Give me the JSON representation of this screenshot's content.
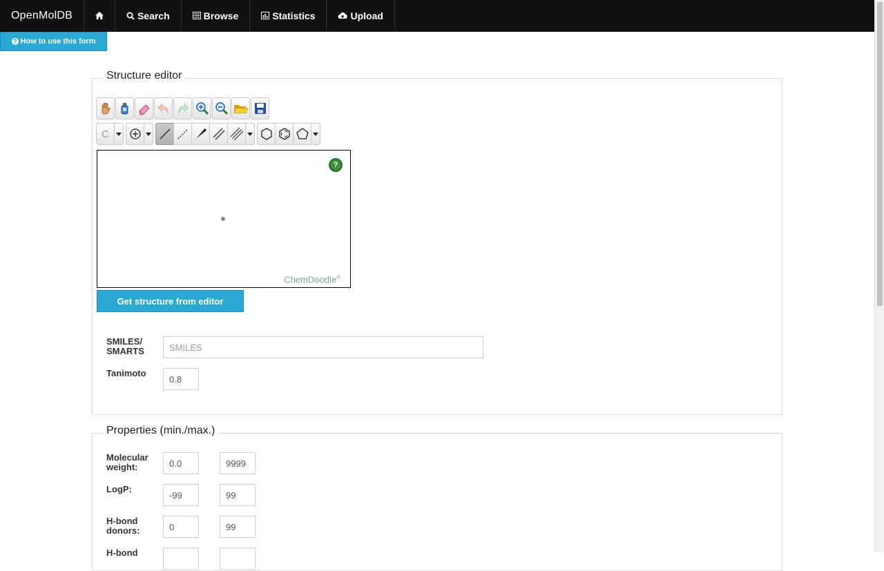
{
  "nav": {
    "brand": "OpenMolDB",
    "items": [
      {
        "label": "Search",
        "icon": "search-icon"
      },
      {
        "label": "Browse",
        "icon": "list-icon"
      },
      {
        "label": "Statistics",
        "icon": "bar-chart-icon"
      },
      {
        "label": "Upload",
        "icon": "cloud-upload-icon"
      }
    ]
  },
  "help_button": {
    "label": "How to use this form"
  },
  "structure_editor": {
    "legend": "Structure editor",
    "element_label": "C",
    "watermark": "ChemDoodle",
    "watermark_reg": "®",
    "help_symbol": "?",
    "get_button": "Get structure from editor",
    "smiles_label": "SMILES/\nSMARTS",
    "smiles_placeholder": "SMILES",
    "tanimoto_label": "Tanimoto",
    "tanimoto_value": "0.8"
  },
  "properties": {
    "legend": "Properties (min./max.)",
    "rows": [
      {
        "label": "Molecular\nweight:",
        "min": "0.0",
        "max": "9999"
      },
      {
        "label": "LogP:",
        "min": "-99",
        "max": "99"
      },
      {
        "label": "H-bond\ndonors:",
        "min": "0",
        "max": "99"
      },
      {
        "label": "H-bond",
        "min": "",
        "max": ""
      }
    ]
  }
}
